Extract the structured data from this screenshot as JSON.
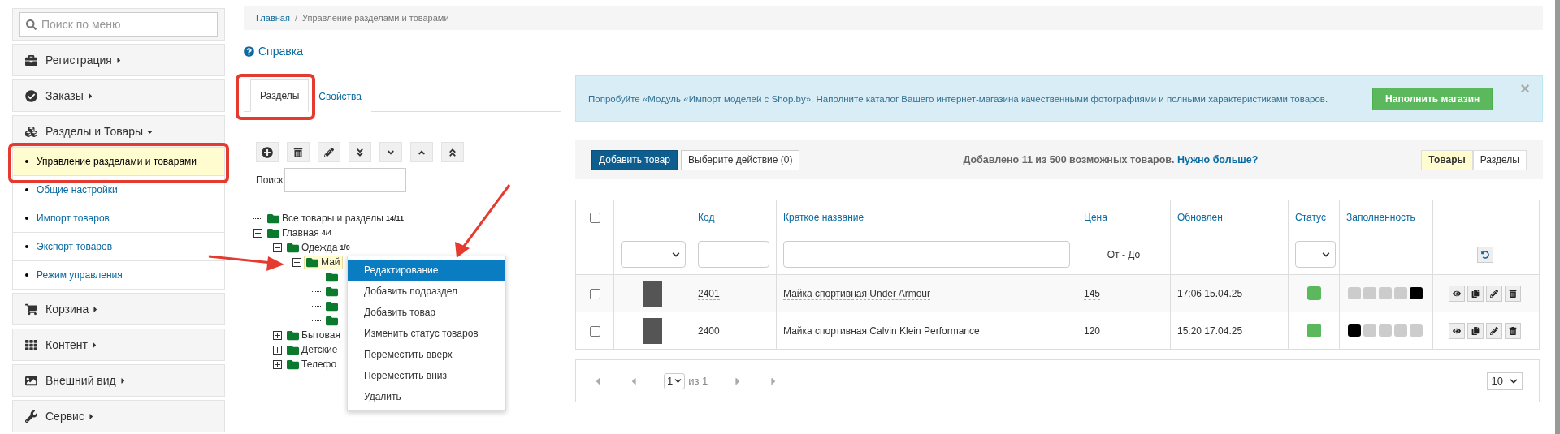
{
  "sidebar": {
    "search": {
      "placeholder": "Поиск по меню"
    },
    "groups": [
      {
        "label": "Регистрация",
        "expanded": false
      },
      {
        "label": "Заказы",
        "expanded": false
      },
      {
        "label": "Разделы и Товары",
        "expanded": true,
        "items": [
          {
            "label": "Управление разделами и товарами",
            "selected": true
          },
          {
            "label": "Общие настройки",
            "selected": false
          },
          {
            "label": "Импорт товаров",
            "selected": false
          },
          {
            "label": "Экспорт товаров",
            "selected": false
          },
          {
            "label": "Режим управления",
            "selected": false
          }
        ]
      },
      {
        "label": "Корзина",
        "expanded": false
      },
      {
        "label": "Контент",
        "expanded": false
      },
      {
        "label": "Внешний вид",
        "expanded": false
      },
      {
        "label": "Сервис",
        "expanded": false
      }
    ]
  },
  "breadcrumb": [
    {
      "label": "Главная",
      "link": true
    },
    {
      "label": "Управление разделами и товарами",
      "link": false
    }
  ],
  "breadcrumb_separator": "/",
  "help_link": "Справка",
  "tabs": [
    {
      "label": "Разделы",
      "selected": true
    },
    {
      "label": "Свойства",
      "selected": false
    }
  ],
  "tree_search": {
    "label": "Поиск"
  },
  "tree": [
    {
      "label": "Все товары и разделы",
      "badge": "14/11",
      "selected": false
    },
    {
      "label": "Главная",
      "badge": "4/4",
      "selected": false,
      "expanded": true,
      "children": [
        {
          "label": "Одежда",
          "badge": "1/0",
          "selected": false,
          "expanded": true,
          "children": [
            {
              "label": "Май",
              "selected": true,
              "expanded": true,
              "children": [
                {
                  "selected": false
                },
                {
                  "selected": false
                },
                {
                  "selected": false
                },
                {
                  "selected": false
                }
              ]
            }
          ]
        },
        {
          "label": "Бытовая",
          "selected": false,
          "expanded": false
        },
        {
          "label": "Детские",
          "selected": false,
          "expanded": false
        },
        {
          "label": "Телефо",
          "selected": false,
          "expanded": false
        }
      ]
    }
  ],
  "context_menu": [
    {
      "label": "Редактирование",
      "selected": true
    },
    {
      "label": "Добавить подраздел",
      "selected": false
    },
    {
      "label": "Добавить товар",
      "selected": false
    },
    {
      "label": "Изменить статус товаров",
      "selected": false
    },
    {
      "label": "Переместить вверх",
      "selected": false
    },
    {
      "label": "Переместить вниз",
      "selected": false
    },
    {
      "label": "Удалить",
      "selected": false
    }
  ],
  "banner": {
    "text": "Попробуйте «Модуль «Импорт моделей с Shop.by». Наполните каталог Вашего интернет-магазина качественными фотографиями и полными характеристиками товаров.",
    "button": "Наполнить магазин",
    "close": "×"
  },
  "toolbar": {
    "add_button": "Добавить товар",
    "action_button": "Выберите действие (0)",
    "info": "Добавлено 11 из 500 возможных товаров.",
    "info_link": "Нужно больше?",
    "views": [
      {
        "label": "Товары",
        "selected": true
      },
      {
        "label": "Разделы",
        "selected": false
      }
    ]
  },
  "table": {
    "all_checked": false,
    "columns": [
      "Код",
      "Краткое название",
      "Цена",
      "Обновлен",
      "Статус",
      "Заполненность"
    ],
    "price_filter": "От - До",
    "rows": [
      {
        "checked": false,
        "code": "2401",
        "name": "Майка спортивная Under Armour",
        "price": "145",
        "updated": "17:06 15.04.25",
        "active": true,
        "completeness": [
          false,
          false,
          false,
          false,
          true
        ]
      },
      {
        "checked": false,
        "code": "2400",
        "name": "Майка спортивная Calvin Klein Performance",
        "price": "120",
        "updated": "15:20 17.04.25",
        "active": true,
        "completeness": [
          true,
          false,
          false,
          false,
          false
        ]
      }
    ]
  },
  "pagination": {
    "page": "1",
    "of": "из 1",
    "per_page": "10"
  }
}
